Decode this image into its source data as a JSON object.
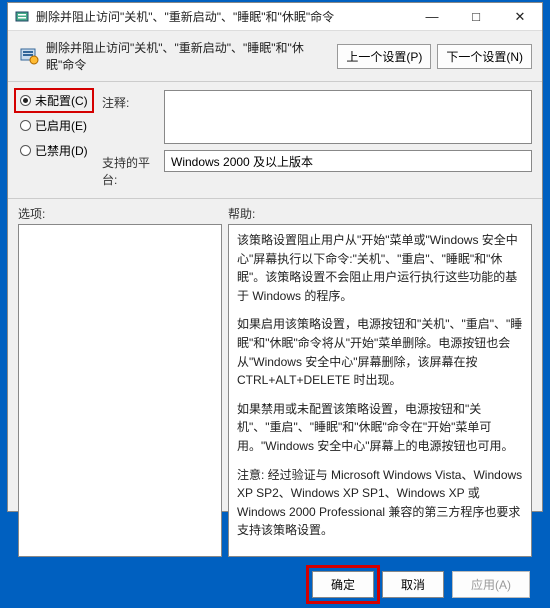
{
  "window": {
    "title": "删除并阻止访问\"关机\"、\"重新启动\"、\"睡眠\"和\"休眠\"命令",
    "minimize": "—",
    "maximize": "□",
    "close": "✕"
  },
  "header": {
    "policy_title": "删除并阻止访问\"关机\"、\"重新启动\"、\"睡眠\"和\"休眠\"命令",
    "prev": "上一个设置(P)",
    "next": "下一个设置(N)"
  },
  "radios": {
    "not_configured": "未配置(C)",
    "enabled": "已启用(E)",
    "disabled": "已禁用(D)",
    "selected": "not_configured"
  },
  "fields": {
    "comment_label": "注释:",
    "comment_value": "",
    "supported_label": "支持的平台:",
    "supported_value": "Windows 2000 及以上版本"
  },
  "midlabels": {
    "options": "选项:",
    "help": "帮助:"
  },
  "help_paragraphs": [
    "该策略设置阻止用户从\"开始\"菜单或\"Windows 安全中心\"屏幕执行以下命令:\"关机\"、\"重启\"、\"睡眠\"和\"休眠\"。该策略设置不会阻止用户运行执行这些功能的基于 Windows 的程序。",
    "如果启用该策略设置，电源按钮和\"关机\"、\"重启\"、\"睡眠\"和\"休眠\"命令将从\"开始\"菜单删除。电源按钮也会从\"Windows 安全中心\"屏幕删除，该屏幕在按 CTRL+ALT+DELETE 时出现。",
    "如果禁用或未配置该策略设置，电源按钮和\"关机\"、\"重启\"、\"睡眠\"和\"休眠\"命令在\"开始\"菜单可用。\"Windows 安全中心\"屏幕上的电源按钮也可用。",
    "注意: 经过验证与 Microsoft Windows Vista、Windows XP SP2、Windows XP SP1、Windows XP 或 Windows 2000 Professional 兼容的第三方程序也要求支持该策略设置。"
  ],
  "footer": {
    "ok": "确定",
    "cancel": "取消",
    "apply": "应用(A)"
  },
  "icons": {
    "policy": "policy-icon",
    "app": "app-icon"
  }
}
